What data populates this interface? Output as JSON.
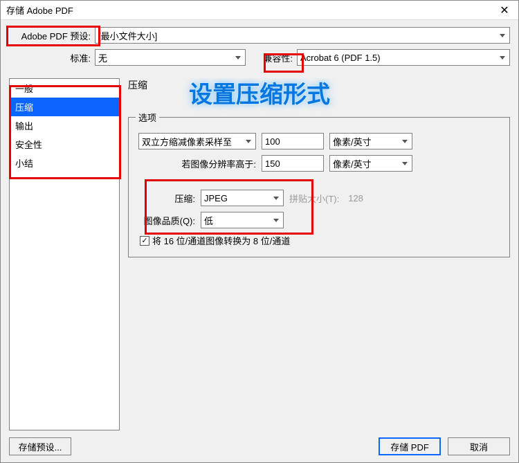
{
  "window": {
    "title": "存储 Adobe PDF"
  },
  "top": {
    "preset_label": "Adobe PDF 预设:",
    "preset_value": "[最小文件大小]",
    "standard_label": "标准:",
    "standard_value": "无",
    "compat_label": "兼容性:",
    "compat_value": "Acrobat 6 (PDF 1.5)"
  },
  "sidebar": {
    "items": [
      "一般",
      "压缩",
      "输出",
      "安全性",
      "小结"
    ],
    "selected_index": 1
  },
  "panel": {
    "title": "压缩",
    "annotation": "设置压缩形式",
    "group_legend": "选项",
    "downsample_method": "双立方缩减像素采样至",
    "downsample_value": "100",
    "unit": "像素/英寸",
    "threshold_label": "若图像分辨率高于:",
    "threshold_value": "150",
    "compress_label": "压缩:",
    "compress_value": "JPEG",
    "tile_label": "拼贴大小(T):",
    "tile_value": "128",
    "quality_label": "图像品质(Q):",
    "quality_value": "低",
    "checkbox_label": "将 16 位/通道图像转换为 8 位/通道",
    "checkbox_checked": true
  },
  "buttons": {
    "save_preset": "存储预设...",
    "save_pdf": "存储 PDF",
    "cancel": "取消"
  }
}
